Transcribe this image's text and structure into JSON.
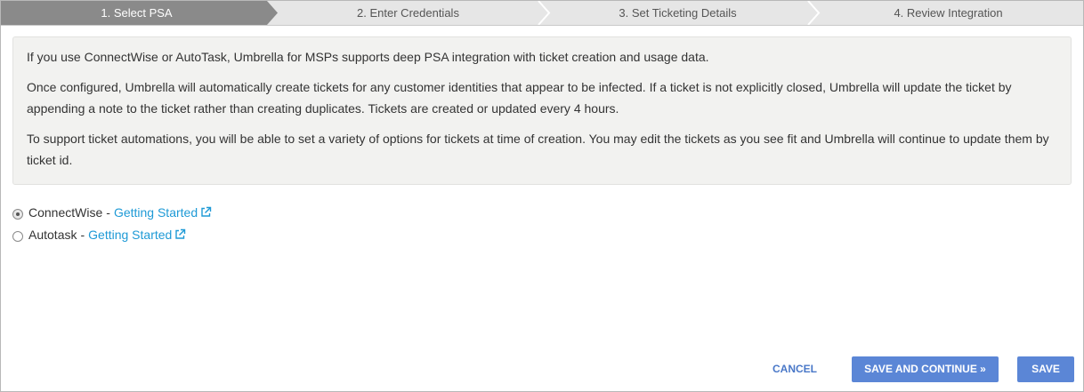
{
  "wizard": {
    "steps": [
      {
        "label": "1. Select PSA",
        "active": true
      },
      {
        "label": "2. Enter Credentials",
        "active": false
      },
      {
        "label": "3. Set Ticketing Details",
        "active": false
      },
      {
        "label": "4. Review Integration",
        "active": false
      }
    ]
  },
  "info": {
    "para1": "If you use ConnectWise or AutoTask, Umbrella for MSPs supports deep PSA integration with ticket creation and usage data.",
    "para2": "Once configured, Umbrella will automatically create tickets for any customer identities that appear to be infected. If a ticket is not explicitly closed, Umbrella will update the ticket by appending a note to the ticket rather than creating duplicates. Tickets are created or updated every 4 hours.",
    "para3": "To support ticket automations, you will be able to set a variety of options for tickets at time of creation. You may edit the tickets as you see fit and Umbrella will continue to update them by ticket id."
  },
  "psa_options": [
    {
      "name": "ConnectWise",
      "separator": "-",
      "link": "Getting Started",
      "selected": true
    },
    {
      "name": "Autotask",
      "separator": "-",
      "link": "Getting Started",
      "selected": false
    }
  ],
  "icons": {
    "external_link": "external-link-icon"
  },
  "colors": {
    "active_step": "#8a8a8a",
    "link": "#1e9ad6",
    "primary_button": "#5b86d6",
    "cancel": "#4a78c8"
  },
  "actions": {
    "cancel": "CANCEL",
    "save_continue": "SAVE AND CONTINUE »",
    "save": "SAVE"
  }
}
